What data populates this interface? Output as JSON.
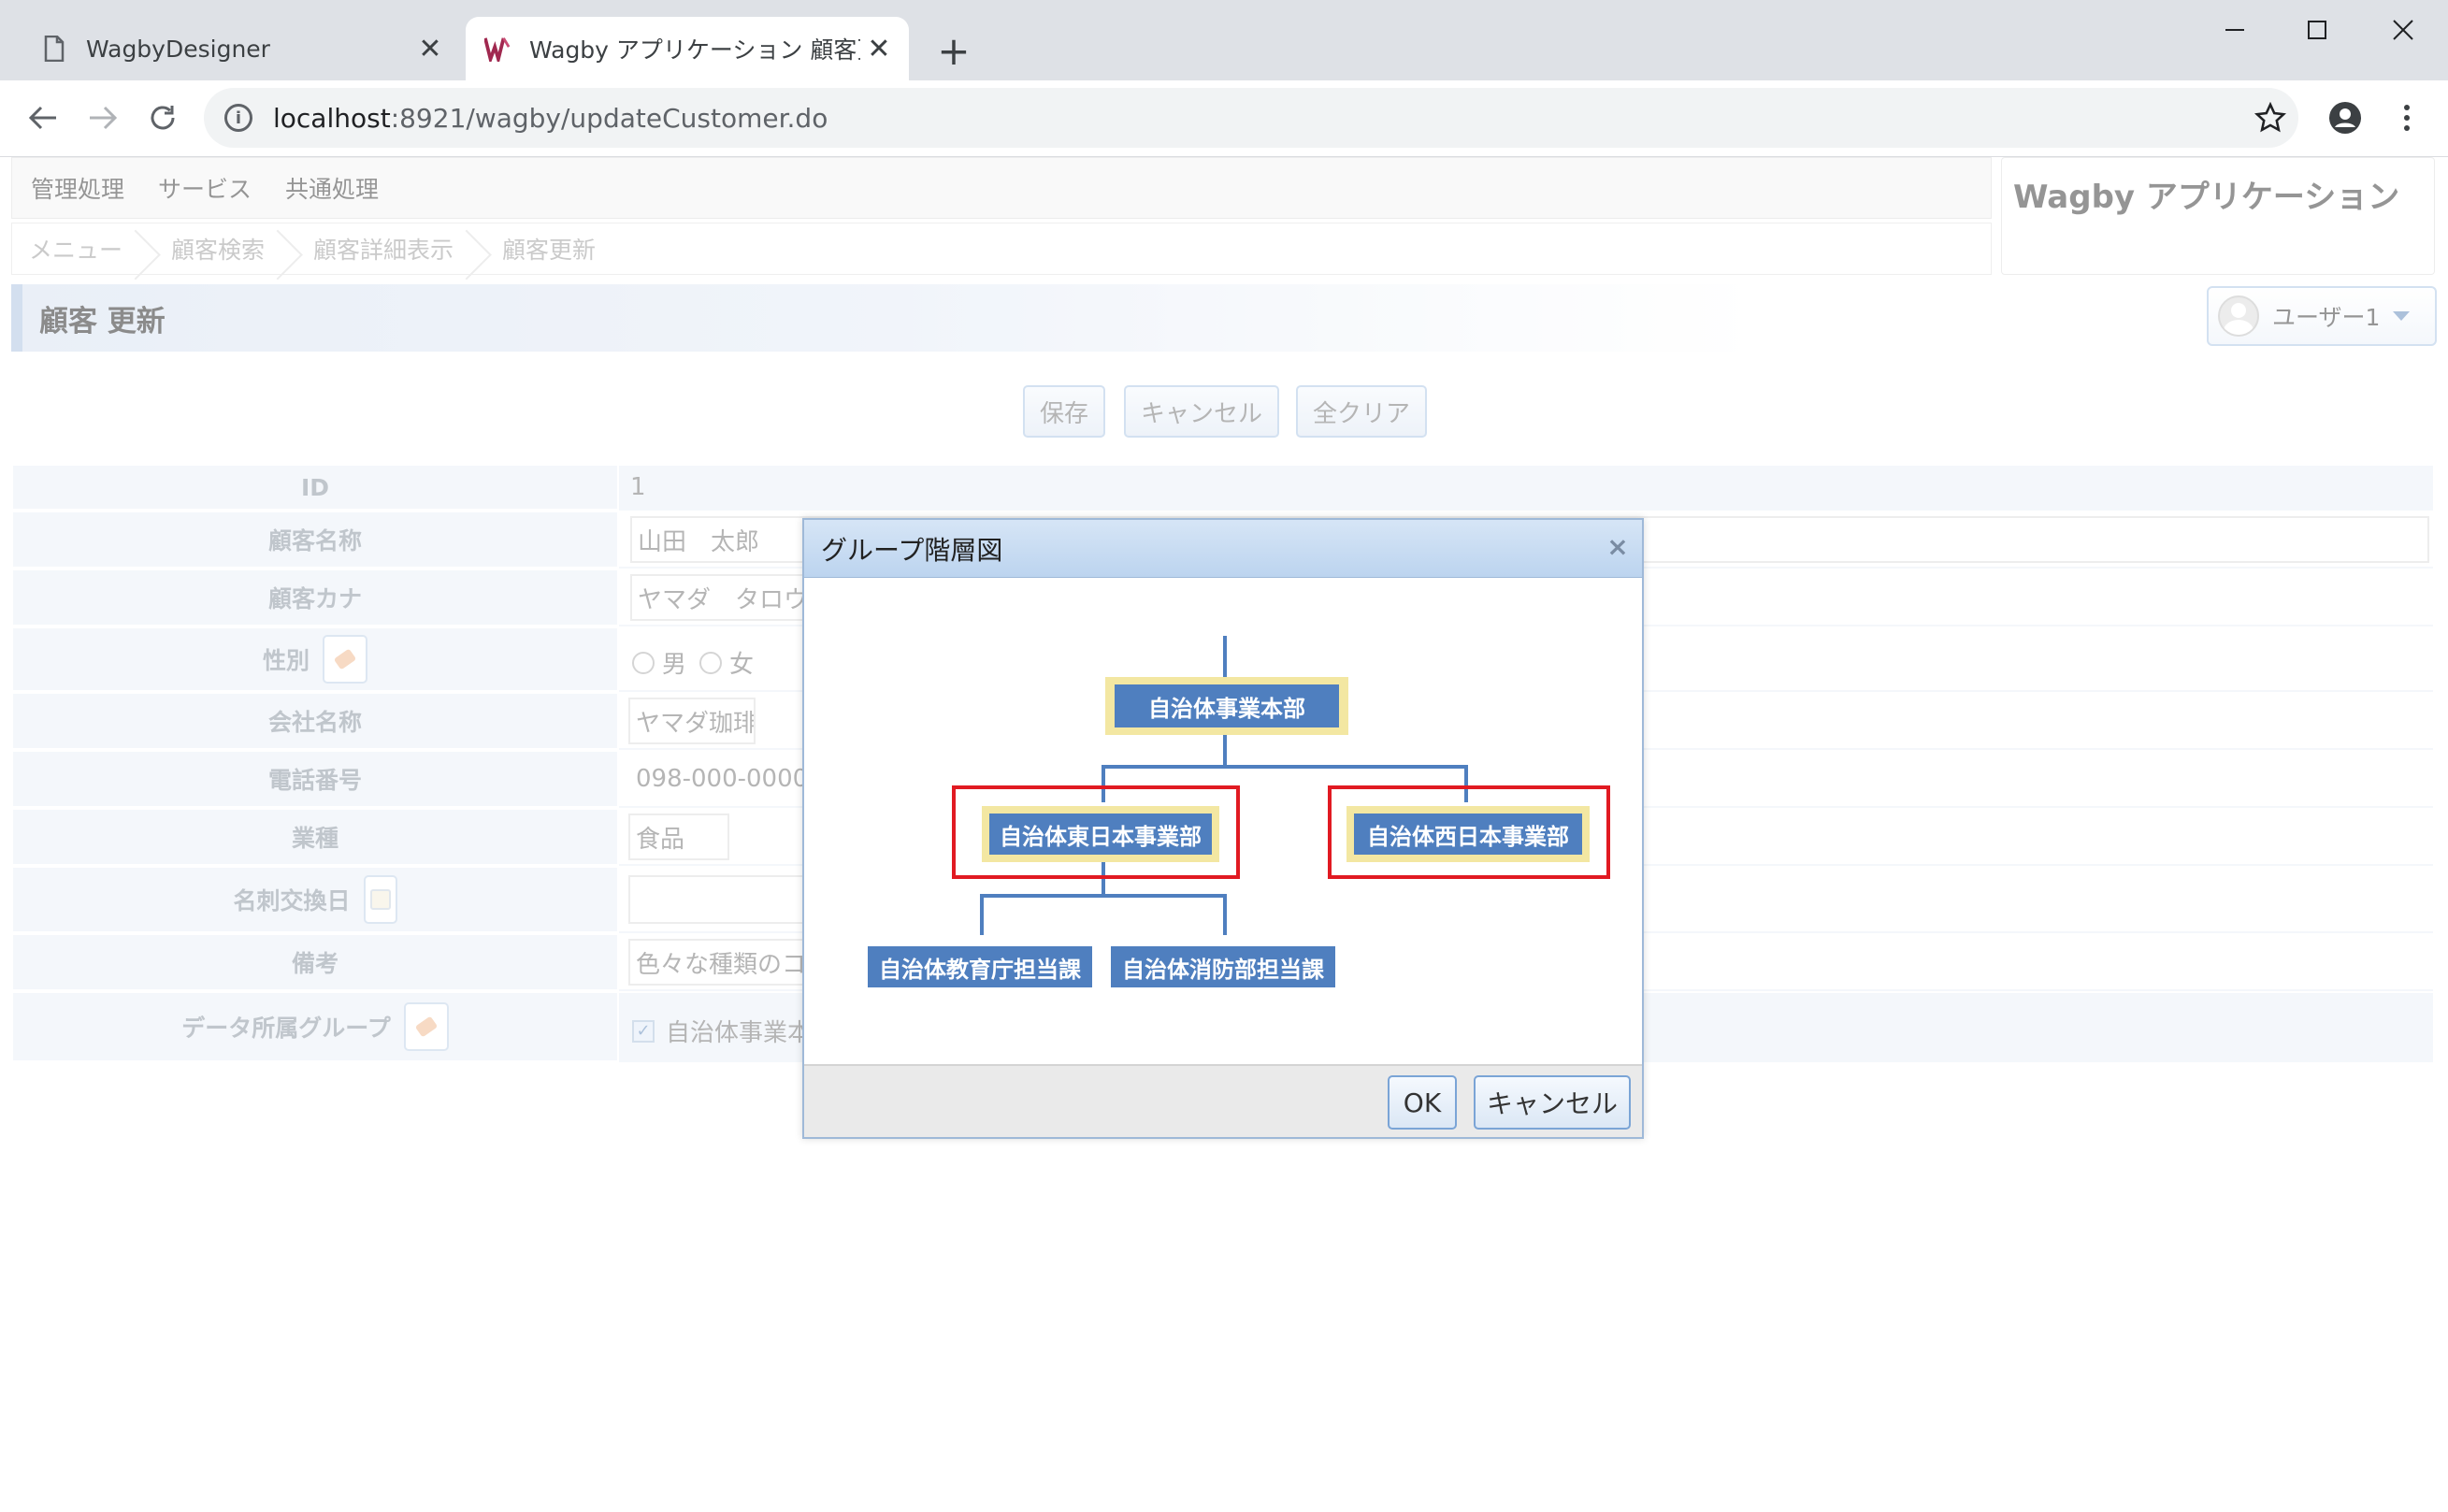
{
  "browser": {
    "tabs": [
      {
        "title": "WagbyDesigner"
      },
      {
        "title": "Wagby アプリケーション 顧客更新"
      }
    ],
    "url_host": "localhost",
    "url_rest": ":8921/wagby/updateCustomer.do"
  },
  "menu": [
    "管理処理",
    "サービス",
    "共通処理"
  ],
  "breadcrumb": [
    "メニュー",
    "顧客検索",
    "顧客詳細表示",
    "顧客更新"
  ],
  "app_title": "Wagby アプリケーション",
  "page_title": "顧客 更新",
  "user": {
    "name": "ユーザー1"
  },
  "actions": {
    "save": "保存",
    "cancel": "キャンセル",
    "clear_all": "全クリア"
  },
  "form": {
    "id": {
      "label": "ID",
      "value": "1"
    },
    "name": {
      "label": "顧客名称",
      "value": "山田　太郎"
    },
    "kana": {
      "label": "顧客カナ",
      "value": "ヤマダ　タロウ"
    },
    "gender": {
      "label": "性別",
      "options": [
        "男",
        "女"
      ]
    },
    "company": {
      "label": "会社名称",
      "value": "ヤマダ珈琲"
    },
    "phone": {
      "label": "電話番号",
      "value": "098-000-0000"
    },
    "industry": {
      "label": "業種",
      "value": "食品"
    },
    "card_date": {
      "label": "名刺交換日",
      "value": ""
    },
    "notes": {
      "label": "備考",
      "value": "色々な種類のコ"
    },
    "group": {
      "label": "データ所属グループ",
      "value": "自治体事業本"
    }
  },
  "dialog": {
    "title": "グループ階層図",
    "close": "×",
    "ok": "OK",
    "cancel": "キャンセル",
    "tree": {
      "root": "自治体事業本部",
      "east": "自治体東日本事業部",
      "west": "自治体西日本事業部",
      "edu": "自治体教育庁担当課",
      "fire": "自治体消防部担当課"
    }
  },
  "colors": {
    "node_blue": "#4f7fbf",
    "node_highlight": "#f3e7a2",
    "selection_red": "#e11a22",
    "label_bg": "#eef2f8"
  }
}
